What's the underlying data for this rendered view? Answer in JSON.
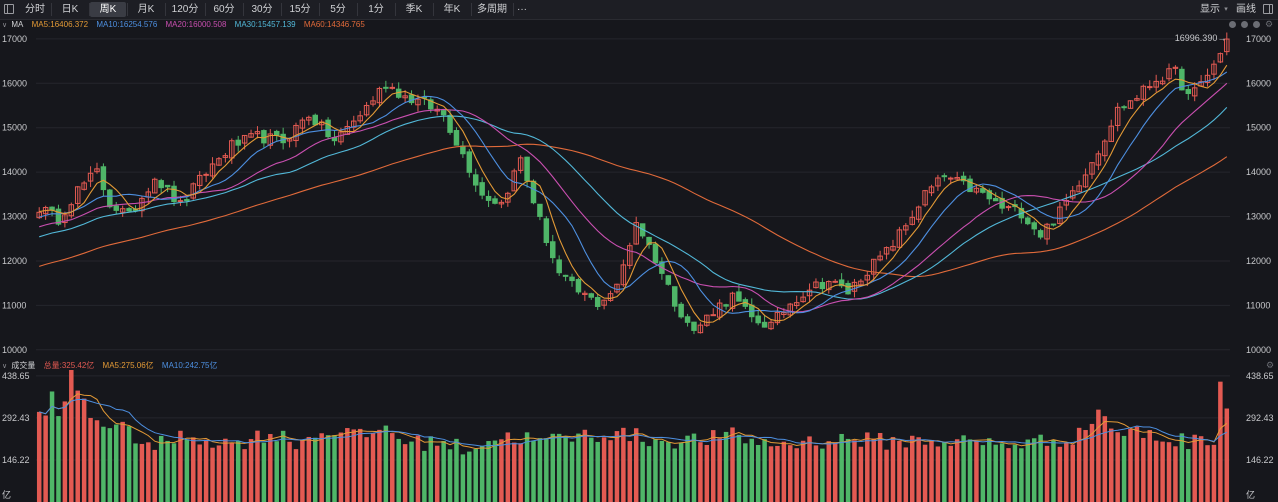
{
  "toolbar": {
    "items": [
      "分时",
      "日K",
      "周K",
      "月K",
      "120分",
      "60分",
      "30分",
      "15分",
      "5分",
      "1分",
      "季K",
      "年K",
      "多周期"
    ],
    "active_index": 2,
    "more": "···",
    "display": "显示",
    "draw": "画线"
  },
  "colors": {
    "up": "#e35a52",
    "down": "#4fb668",
    "ma5": "#e39a36",
    "ma10": "#4d8fe0",
    "ma20": "#c94fb0",
    "ma30": "#52b8d8",
    "ma60": "#e06a3a",
    "grid": "#25262c",
    "background": "#16171c"
  },
  "chart_data": [
    {
      "type": "candlestick",
      "indicator_label": "MA",
      "legend": {
        "ma5": "MA5:16406.372",
        "ma10": "MA10:16254.576",
        "ma20": "MA20:16000.508",
        "ma30": "MA30:15457.139",
        "ma60": "MA60:14346.765"
      },
      "ylim": [
        9950,
        17200
      ],
      "yticks": [
        10000,
        11000,
        12000,
        13000,
        14000,
        15000,
        16000,
        17000
      ],
      "last_price_label": "16996.390",
      "anchors": [
        [
          0,
          13200
        ],
        [
          3,
          12950
        ],
        [
          6,
          13600
        ],
        [
          9,
          14000
        ],
        [
          11,
          13300
        ],
        [
          14,
          13000
        ],
        [
          18,
          13900
        ],
        [
          22,
          13250
        ],
        [
          26,
          14000
        ],
        [
          30,
          14600
        ],
        [
          34,
          14800
        ],
        [
          38,
          14700
        ],
        [
          42,
          15300
        ],
        [
          46,
          14700
        ],
        [
          50,
          15300
        ],
        [
          54,
          16000
        ],
        [
          57,
          15700
        ],
        [
          60,
          15550
        ],
        [
          63,
          15300
        ],
        [
          66,
          14400
        ],
        [
          69,
          13500
        ],
        [
          72,
          13300
        ],
        [
          75,
          14300
        ],
        [
          78,
          12900
        ],
        [
          81,
          11700
        ],
        [
          84,
          11300
        ],
        [
          87,
          11050
        ],
        [
          90,
          11400
        ],
        [
          93,
          12900
        ],
        [
          96,
          12050
        ],
        [
          99,
          11100
        ],
        [
          102,
          10400
        ],
        [
          105,
          10900
        ],
        [
          108,
          11200
        ],
        [
          111,
          10700
        ],
        [
          114,
          10550
        ],
        [
          117,
          11050
        ],
        [
          120,
          11400
        ],
        [
          123,
          11550
        ],
        [
          126,
          11300
        ],
        [
          129,
          11800
        ],
        [
          132,
          12200
        ],
        [
          135,
          12800
        ],
        [
          138,
          13500
        ],
        [
          141,
          13900
        ],
        [
          144,
          13700
        ],
        [
          147,
          13500
        ],
        [
          150,
          13200
        ],
        [
          153,
          13100
        ],
        [
          156,
          12600
        ],
        [
          159,
          13100
        ],
        [
          162,
          13800
        ],
        [
          165,
          14500
        ],
        [
          168,
          15400
        ],
        [
          171,
          15700
        ],
        [
          174,
          16100
        ],
        [
          177,
          16250
        ],
        [
          179,
          15700
        ],
        [
          180,
          15800
        ],
        [
          182,
          16200
        ],
        [
          184,
          16650
        ],
        [
          185,
          16996
        ]
      ],
      "ma_final": {
        "ma5": 16406.372,
        "ma10": 16254.576,
        "ma20": 16000.508,
        "ma30": 15457.139,
        "ma60": 14346.765
      }
    },
    {
      "type": "bar",
      "indicator_label": "成交量",
      "legend": {
        "total": "总量:325.42亿",
        "ma5": "MA5:275.06亿",
        "ma10": "MA10:242.75亿"
      },
      "ylim": [
        0,
        445
      ],
      "yticks": [
        "146.22",
        "292.43",
        "438.65"
      ],
      "ytick_values": [
        146.22,
        292.43,
        438.65
      ],
      "unit": "亿",
      "volume_anchors": [
        [
          0,
          300
        ],
        [
          2,
          360
        ],
        [
          3,
          280
        ],
        [
          5,
          440
        ],
        [
          8,
          300
        ],
        [
          12,
          260
        ],
        [
          15,
          230
        ],
        [
          18,
          190
        ],
        [
          21,
          220
        ],
        [
          24,
          230
        ],
        [
          30,
          200
        ],
        [
          36,
          240
        ],
        [
          40,
          210
        ],
        [
          46,
          255
        ],
        [
          50,
          225
        ],
        [
          54,
          260
        ],
        [
          58,
          200
        ],
        [
          62,
          215
        ],
        [
          66,
          185
        ],
        [
          70,
          215
        ],
        [
          74,
          230
        ],
        [
          78,
          210
        ],
        [
          84,
          230
        ],
        [
          90,
          240
        ],
        [
          96,
          215
        ],
        [
          102,
          215
        ],
        [
          108,
          230
        ],
        [
          114,
          200
        ],
        [
          120,
          210
        ],
        [
          126,
          220
        ],
        [
          132,
          210
        ],
        [
          138,
          215
        ],
        [
          144,
          210
        ],
        [
          150,
          200
        ],
        [
          156,
          210
        ],
        [
          162,
          230
        ],
        [
          165,
          320
        ],
        [
          168,
          240
        ],
        [
          172,
          240
        ],
        [
          176,
          215
        ],
        [
          180,
          210
        ],
        [
          183,
          225
        ],
        [
          184,
          430
        ],
        [
          185,
          325
        ]
      ]
    }
  ]
}
